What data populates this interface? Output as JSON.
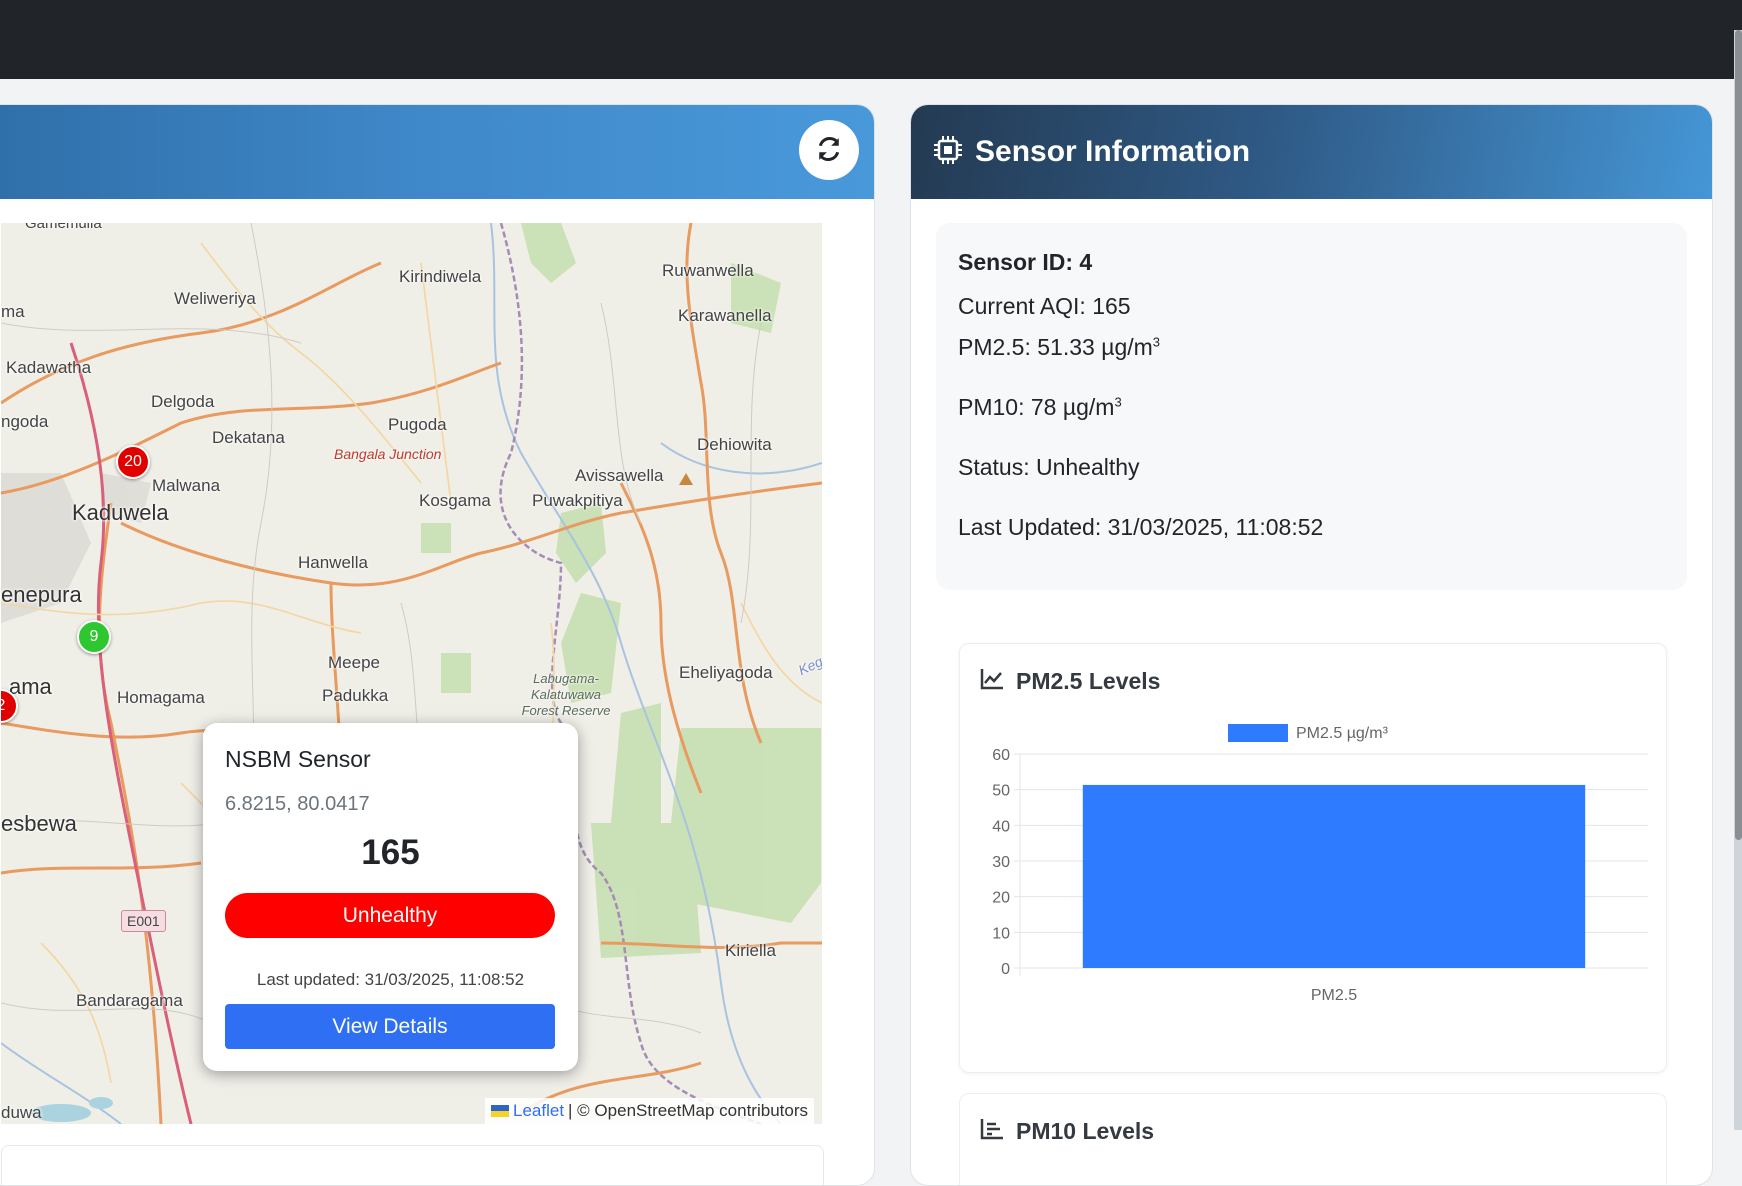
{
  "map": {
    "refresh_icon": "refresh-icon",
    "places": [
      {
        "name": "Gamemulla"
      },
      {
        "name": "Kirindiwela"
      },
      {
        "name": "Ruwanwella"
      },
      {
        "name": "Weliweriya"
      },
      {
        "name": "Karawanella"
      },
      {
        "name": "ma"
      },
      {
        "name": "Kadawatha"
      },
      {
        "name": "Delgoda"
      },
      {
        "name": "ngoda"
      },
      {
        "name": "Pugoda"
      },
      {
        "name": "Dekatana"
      },
      {
        "name": "Dehiowita"
      },
      {
        "name": "Malwana"
      },
      {
        "name": "Avissawella"
      },
      {
        "name": "Kaduwela"
      },
      {
        "name": "Kosgama"
      },
      {
        "name": "Puwakpitiya"
      },
      {
        "name": "Hanwella"
      },
      {
        "name": "enepura"
      },
      {
        "name": "Meepe"
      },
      {
        "name": "Eheliyagoda"
      },
      {
        "name": "ama"
      },
      {
        "name": "Homagama"
      },
      {
        "name": "Padukka"
      },
      {
        "name": "esbewa"
      },
      {
        "name": "Kiriella"
      },
      {
        "name": "Bandaragama"
      },
      {
        "name": "duwa"
      },
      {
        "name": "Bangala Junction"
      },
      {
        "name": "Labugama-Kalatuwawa Forest Reserve"
      },
      {
        "name": "Kegalle"
      }
    ],
    "markers": [
      {
        "label": "20",
        "level": "red"
      },
      {
        "label": "9",
        "level": "green"
      },
      {
        "label": "2",
        "level": "red"
      }
    ],
    "road_shield": "E001",
    "popup": {
      "title": "NSBM Sensor",
      "coords": "6.8215, 80.0417",
      "aqi": "165",
      "status": "Unhealthy",
      "status_color": "#ff0000",
      "updated": "Last updated: 31/03/2025, 11:08:52",
      "button": "View Details"
    },
    "attribution": {
      "link": "Leaflet",
      "text": "| © OpenStreetMap contributors"
    }
  },
  "sensor": {
    "title": "Sensor Information",
    "icon": "chip-icon",
    "id_line": "Sensor ID: 4",
    "aqi_line": "Current AQI: 165",
    "pm25_line": "PM2.5: 51.33 µg/m",
    "pm10_line": "PM10: 78 µg/m",
    "unit_sup": "3",
    "status_line": "Status: Unhealthy",
    "updated_line": "Last Updated: 31/03/2025, 11:08:52"
  },
  "charts": {
    "pm25_title": "PM2.5 Levels",
    "pm10_title": "PM10 Levels"
  },
  "chart_data": {
    "type": "bar",
    "categories": [
      "PM2.5"
    ],
    "series": [
      {
        "name": "PM2.5 µg/m³",
        "values": [
          51.33
        ]
      }
    ],
    "ylim": [
      0,
      60
    ],
    "yticks": [
      0,
      10,
      20,
      30,
      40,
      50,
      60
    ],
    "color": "#2f7bff",
    "grid": true,
    "legend": "top"
  },
  "colors": {
    "accent": "#2f6ff3",
    "unhealthy": "#ff0000"
  }
}
